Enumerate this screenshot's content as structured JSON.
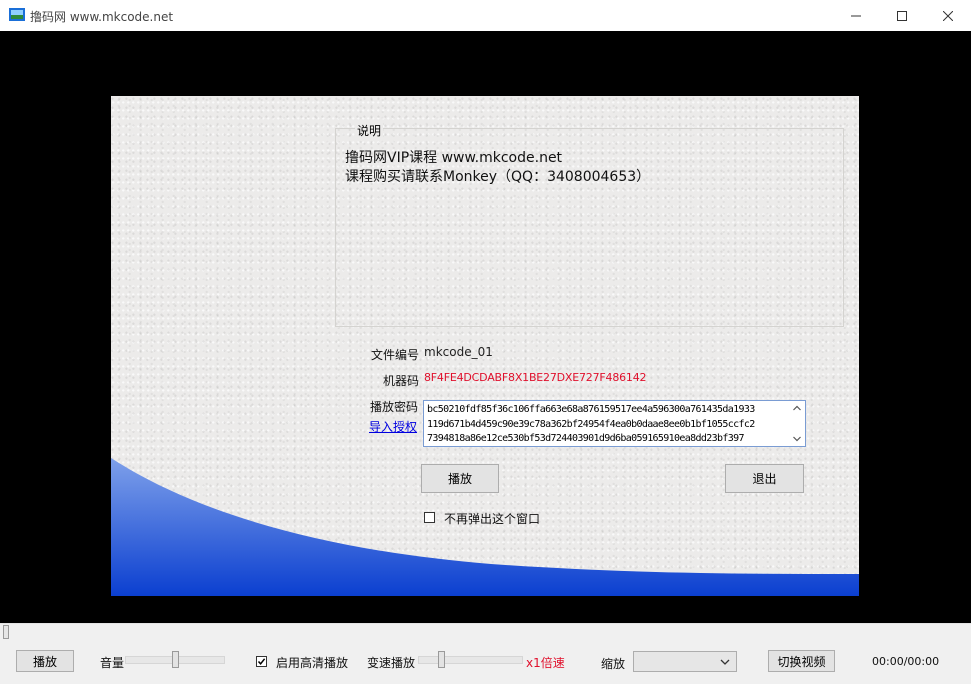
{
  "window": {
    "title": "撸码网 www.mkcode.net",
    "icons": [
      "app-icon",
      "minimize-icon",
      "maximize-icon",
      "close-icon"
    ]
  },
  "dialog": {
    "group_label": "说明",
    "info_line1": "撸码网VIP课程 www.mkcode.net",
    "info_line2": "课程购买请联系Monkey（QQ：3408004653）",
    "file_no_label": "文件编号",
    "file_no_value": "mkcode_01",
    "machine_code_label": "机器码",
    "machine_code_value": "8F4FE4DCDABF8X1BE27DXE727F486142",
    "play_password_label": "播放密码",
    "import_auth_link": "导入授权",
    "password_value": "bc50210fdf85f36c106ffa663e68a876159517ee4a596300a761435da1933\n119d671b4d459c90e39c78a362bf24954f4ea0b0daae8ee0b1bf1055ccfc2\n7394818a86e12ce530bf53d724403901d9d6ba059165910ea8dd23bf397",
    "play_button": "播放",
    "exit_button": "退出",
    "no_popup_label": "不再弹出这个窗口",
    "no_popup_checked": false,
    "wave_colors": [
      "#7ea0ea",
      "#0b3fd0"
    ]
  },
  "toolbar": {
    "play_button": "播放",
    "volume_label": "音量",
    "volume_level": 0.5,
    "hd_label": "启用高清播放",
    "hd_checked": true,
    "speed_label": "变速播放",
    "speed_level": 0.2,
    "speed_value": "x1倍速",
    "zoom_label": "缩放",
    "zoom_value": "",
    "switch_video_button": "切换视频",
    "time": "00:00/00:00",
    "progress": 0
  }
}
